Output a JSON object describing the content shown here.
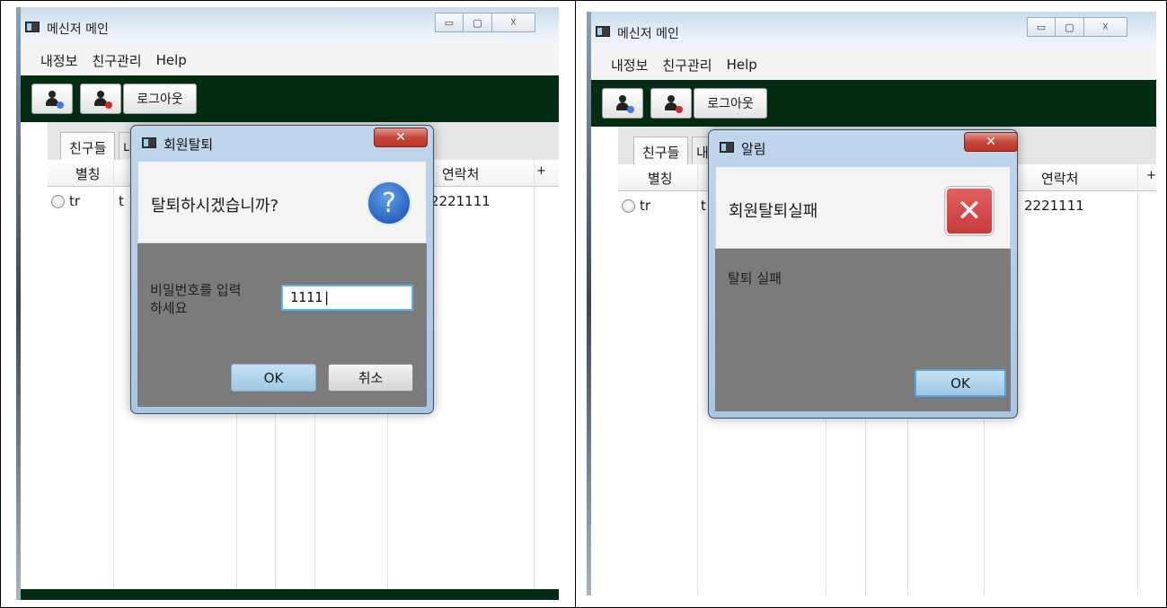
{
  "left": {
    "window": {
      "title": "메신저 메인",
      "controls": [
        "▭",
        "▢",
        "☓"
      ],
      "menu": [
        "내정보",
        "친구관리",
        "Help"
      ],
      "toolbar": {
        "logout_label": "로그아웃"
      },
      "tabs": [
        "친구들",
        "내"
      ],
      "table": {
        "headers": {
          "nickname": "별칭",
          "contact": "연락처",
          "add": "+"
        },
        "rows": [
          {
            "nickname": "tr",
            "name_partial": "t",
            "contact": "2221111"
          }
        ]
      }
    },
    "dialog": {
      "title": "회원탈퇴",
      "close": "✕",
      "question": "탈퇴하시겠습니까?",
      "icon": "?",
      "prompt": "비밀번호를 입력하세요",
      "input_value": "1111|",
      "ok_label": "OK",
      "cancel_label": "취소"
    }
  },
  "right": {
    "window": {
      "title": "메신저 메인",
      "controls": [
        "▭",
        "▢",
        "☓"
      ],
      "menu": [
        "내정보",
        "친구관리",
        "Help"
      ],
      "toolbar": {
        "logout_label": "로그아웃"
      },
      "tabs": [
        "친구들",
        "내"
      ],
      "table": {
        "headers": {
          "nickname": "별칭",
          "contact": "연락처",
          "add": "+"
        },
        "rows": [
          {
            "nickname": "tr",
            "name_partial": "t",
            "contact": "2221111"
          }
        ]
      }
    },
    "dialog": {
      "title": "알림",
      "close": "✕",
      "message": "회원탈퇴실패",
      "icon": "✕",
      "detail": "탈퇴 실패",
      "ok_label": "OK"
    }
  },
  "colors": {
    "toolbar": "#022d12",
    "dialog_body": "#7b7b7b",
    "error_icon": "#d04545",
    "question_icon": "#2b64c0"
  }
}
